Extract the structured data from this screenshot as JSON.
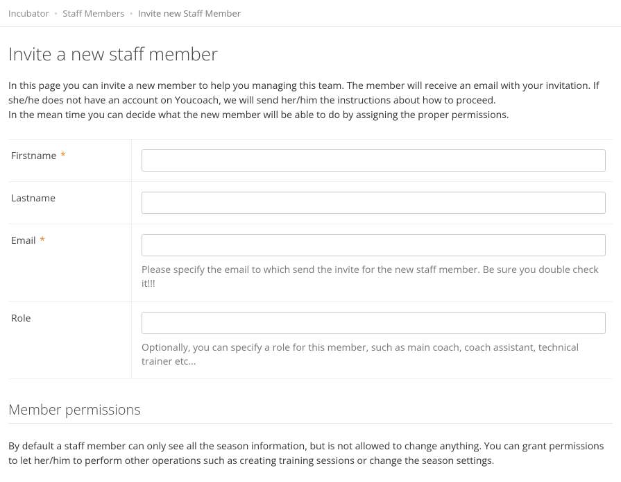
{
  "breadcrumb": {
    "items": [
      {
        "label": "Incubator"
      },
      {
        "label": "Staff Members"
      }
    ],
    "current": "Invite new Staff Member"
  },
  "page": {
    "title": "Invite a new staff member",
    "intro_line1": "In this page you can invite a new member to help you managing this team. The member will receive an email with your invitation. If she/he does not have an account on Youcoach, we will send her/him the instructions about how to proceed.",
    "intro_line2": "In the mean time you can decide what the new member will be able to do by assigning the proper permissions."
  },
  "form": {
    "firstname": {
      "label": "Firstname",
      "required": true,
      "value": ""
    },
    "lastname": {
      "label": "Lastname",
      "required": false,
      "value": ""
    },
    "email": {
      "label": "Email",
      "required": true,
      "value": "",
      "help": "Please specify the email to which send the invite for the new staff member. Be sure you double check it!!!"
    },
    "role": {
      "label": "Role",
      "required": false,
      "value": "",
      "help": "Optionally, you can specify a role for this member, such as main coach, coach assistant, technical trainer etc..."
    }
  },
  "permissions": {
    "heading": "Member permissions",
    "text": "By default a staff member can only see all the season information, but is not allowed to change anything. You can grant permissions to let her/him to perform other operations such as creating training sessions or change the season settings."
  },
  "required_marker": "*"
}
